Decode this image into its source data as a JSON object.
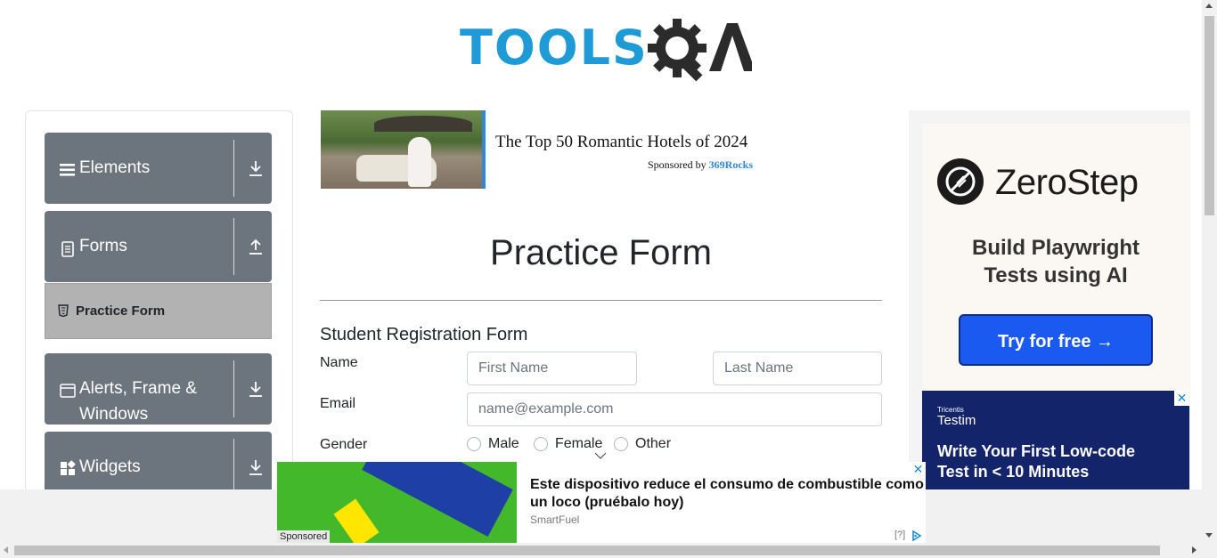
{
  "header": {
    "logo_text": "TOOLSQA",
    "logo_main": "TOOLS"
  },
  "sidebar": {
    "groups": [
      {
        "label": "Elements",
        "icon": "list-icon",
        "arrow": "download-icon"
      },
      {
        "label": "Forms",
        "icon": "document-icon",
        "arrow": "upload-icon"
      },
      {
        "label": "Alerts, Frame &",
        "label_line2": "Windows",
        "icon": "window-icon",
        "arrow": "download-icon"
      },
      {
        "label": "Widgets",
        "icon": "widgets-icon",
        "arrow": "download-icon"
      }
    ],
    "active_item": {
      "label": "Practice Form",
      "icon": "html5-icon"
    }
  },
  "top_ad": {
    "title": "The Top 50 Romantic Hotels of 2024",
    "sponsored_prefix": "Sponsored by",
    "sponsor": "369Rocks"
  },
  "main": {
    "page_title": "Practice Form",
    "form_title": "Student Registration Form",
    "name_label": "Name",
    "first_name_placeholder": "First Name",
    "last_name_placeholder": "Last Name",
    "email_label": "Email",
    "email_placeholder": "name@example.com",
    "gender_label": "Gender",
    "gender_options": [
      "Male",
      "Female",
      "Other"
    ]
  },
  "right_ad": {
    "brand": "ZeroStep",
    "tagline_line1": "Build Playwright",
    "tagline_line2": "Tests using AI",
    "cta": "Try for free →",
    "testim_small": "Tricentis",
    "testim_brand": "Testim",
    "testim_text_line1": "Write Your First Low-code",
    "testim_text_line2": "Test in < 10 Minutes",
    "close": "✕"
  },
  "bottom_ad": {
    "title": "Este dispositivo reduce el consumo de combustible como un loco (pruébalo hoy)",
    "source": "SmartFuel",
    "sponsored": "Sponsored",
    "help": "[?]",
    "close": "✕"
  },
  "colors": {
    "accent": "#1e9ad6",
    "sidebar_group": "#6c757d",
    "active_item": "#b2b2b2",
    "cta": "#1a5af0",
    "testim_bg": "#14246b"
  }
}
